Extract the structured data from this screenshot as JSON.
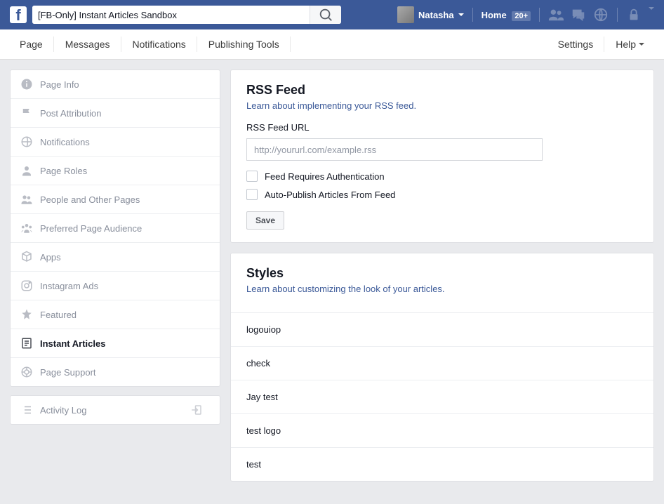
{
  "search": {
    "value": "[FB-Only] Instant Articles Sandbox"
  },
  "user": {
    "name": "Natasha"
  },
  "home": {
    "label": "Home",
    "badge": "20+"
  },
  "tabs": {
    "page": "Page",
    "messages": "Messages",
    "notifications": "Notifications",
    "publishing": "Publishing Tools",
    "settings": "Settings",
    "help": "Help"
  },
  "sidebar": {
    "items": [
      {
        "label": "Page Info"
      },
      {
        "label": "Post Attribution"
      },
      {
        "label": "Notifications"
      },
      {
        "label": "Page Roles"
      },
      {
        "label": "People and Other Pages"
      },
      {
        "label": "Preferred Page Audience"
      },
      {
        "label": "Apps"
      },
      {
        "label": "Instagram Ads"
      },
      {
        "label": "Featured"
      },
      {
        "label": "Instant Articles"
      },
      {
        "label": "Page Support"
      }
    ]
  },
  "activity": {
    "label": "Activity Log"
  },
  "rss": {
    "heading": "RSS Feed",
    "learn": "Learn about implementing your RSS feed.",
    "url_label": "RSS Feed URL",
    "url_placeholder": "http://yoururl.com/example.rss",
    "auth": "Feed Requires Authentication",
    "autopub": "Auto-Publish Articles From Feed",
    "save": "Save"
  },
  "styles": {
    "heading": "Styles",
    "learn": "Learn about customizing the look of your articles.",
    "items": [
      "logouiop",
      "check",
      "Jay test",
      "test logo",
      "test"
    ]
  }
}
